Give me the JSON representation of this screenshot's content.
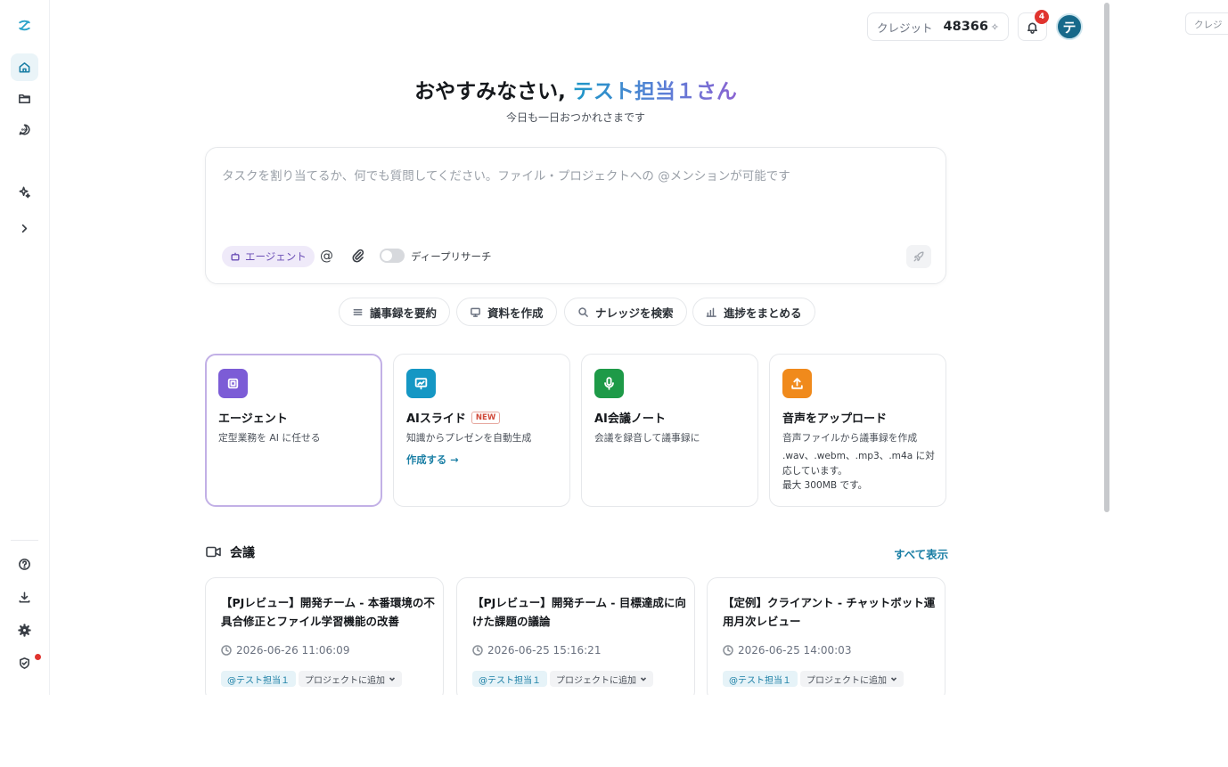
{
  "header": {
    "credit_label": "クレジット",
    "credit_value": "48366",
    "notification_count": "4",
    "avatar_initial": "テ",
    "ghost_credit_label": "クレジ"
  },
  "hero": {
    "greeting_prefix": "おやすみなさい, ",
    "greeting_user": "テスト担当１さん",
    "subtitle": "今日も一日おつかれさまです"
  },
  "composer": {
    "placeholder": "タスクを割り当てるか、何でも質問してください。ファイル・プロジェクトへの @メンションが可能です",
    "agent_chip": "エージェント",
    "mention_symbol": "@",
    "deep_research_label": "ディープリサーチ"
  },
  "quick_actions": [
    {
      "label": "議事録を要約"
    },
    {
      "label": "資料を作成"
    },
    {
      "label": "ナレッジを検索"
    },
    {
      "label": "進捗をまとめる"
    }
  ],
  "features": [
    {
      "title": "エージェント",
      "desc": "定型業務を AI に任せる",
      "color": "#7c5cd6"
    },
    {
      "title": "AIスライド",
      "badge": "NEW",
      "desc": "知識からプレゼンを自動生成",
      "link": "作成する →",
      "color": "#1597c4"
    },
    {
      "title": "AI会議ノート",
      "desc": "会議を録音して議事録に",
      "color": "#1e9a48"
    },
    {
      "title": "音声をアップロード",
      "desc": "音声ファイルから議事録を作成",
      "note_line1": ".wav、.webm、.mp3、.m4a に対応しています。",
      "note_line2": "最大 300MB です。",
      "color": "#f08a1c"
    }
  ],
  "meetings": {
    "title": "会議",
    "view_all": "すべて表示",
    "items": [
      {
        "title": "【PJレビュー】開発チーム - 本番環境の不具合修正とファイル学習機能の改善",
        "datetime": "2026-06-26 11:06:09",
        "tag": "@テスト担当１",
        "project": "プロジェクトに追加"
      },
      {
        "title": "【PJレビュー】開発チーム - 目標達成に向けた課題の議論",
        "datetime": "2026-06-25 15:16:21",
        "tag": "@テスト担当１",
        "project": "プロジェクトに追加"
      },
      {
        "title": "【定例】クライアント - チャットボット運用月次レビュー",
        "datetime": "2026-06-25 14:00:03",
        "tag": "@テスト担当１",
        "project": "プロジェクトに追加"
      }
    ]
  },
  "icons": {
    "sidebar": [
      "logo-icon",
      "home-icon",
      "folder-icon",
      "chat-icon",
      "sparkle-icon",
      "chevron-right-icon",
      "help-icon",
      "download-icon",
      "gear-icon",
      "shield-icon"
    ]
  }
}
